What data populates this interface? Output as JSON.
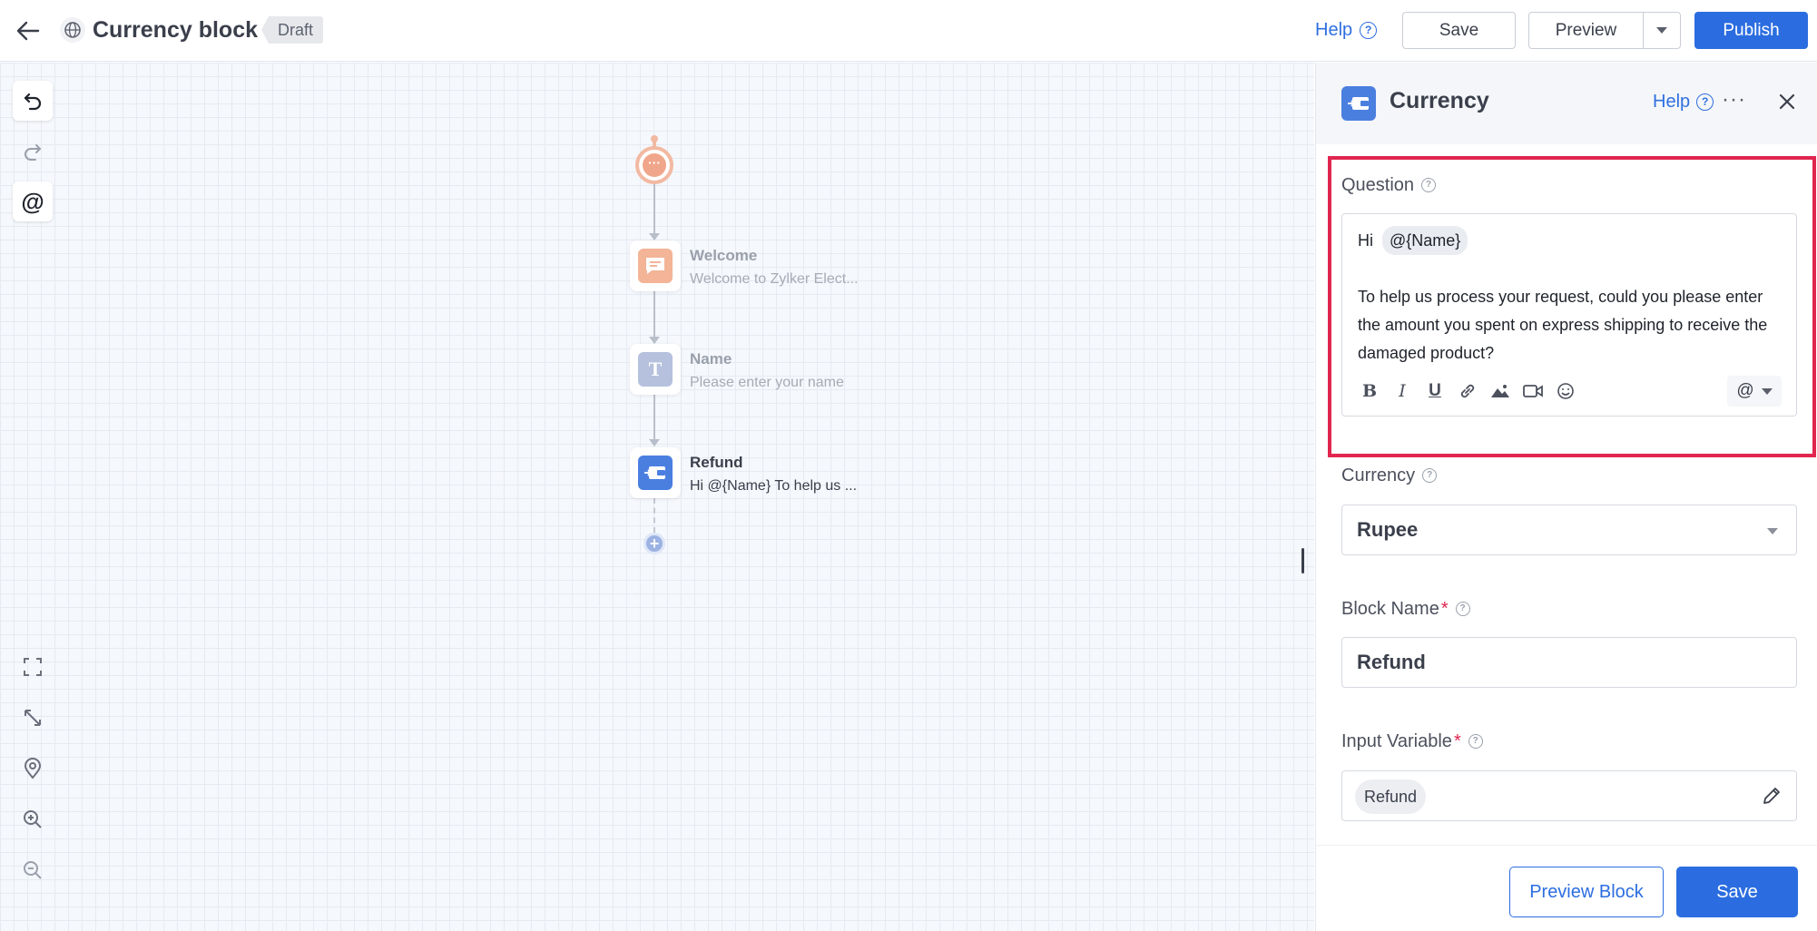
{
  "header": {
    "title": "Currency block",
    "status_badge": "Draft",
    "help_label": "Help",
    "save_label": "Save",
    "preview_label": "Preview",
    "publish_label": "Publish"
  },
  "flow": {
    "nodes": [
      {
        "label": "Welcome",
        "subtitle": "Welcome to Zylker Elect..."
      },
      {
        "label": "Name",
        "subtitle": "Please enter your name"
      },
      {
        "label": "Refund",
        "subtitle": "Hi  @{Name}  To help us ..."
      }
    ]
  },
  "panel": {
    "title": "Currency",
    "help_label": "Help",
    "question": {
      "label": "Question",
      "greeting": "Hi",
      "mention": "@{Name}",
      "body": "To help us process your request, could you please enter the amount you spent on express shipping to receive the damaged product?",
      "mention_button": "@"
    },
    "currency": {
      "label": "Currency",
      "selected": "Rupee"
    },
    "block_name": {
      "label": "Block Name",
      "required_mark": "*",
      "value": "Refund"
    },
    "input_variable": {
      "label": "Input Variable",
      "required_mark": "*",
      "value": "Refund"
    },
    "footer": {
      "preview_block_label": "Preview Block",
      "save_label": "Save"
    }
  },
  "colors": {
    "primary": "#2b6de0",
    "highlight_border": "#e0254f",
    "welcome_node": "#f3b497",
    "name_node": "#b5c1dd",
    "refund_node": "#4a7fe0"
  }
}
